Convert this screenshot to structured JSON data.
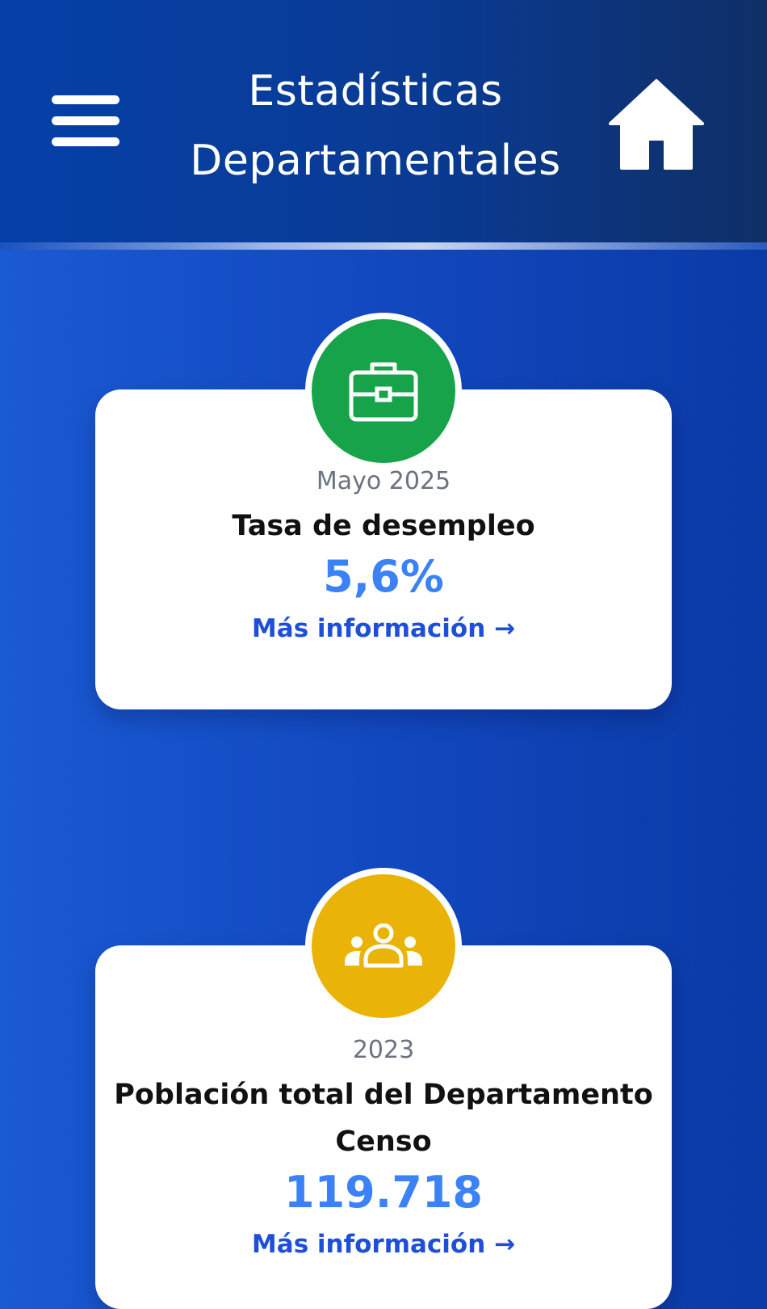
{
  "header": {
    "title_line1": "Estadísticas",
    "title_line2": "Departamentales",
    "menu_icon": "hamburger-menu-icon",
    "home_icon": "home-icon"
  },
  "colors": {
    "header_bg": "#0540a8",
    "page_bg": "#1248bf",
    "card_bg": "#ffffff",
    "unemployment_badge": "#16a34a",
    "population_badge": "#eab308",
    "value_color": "#3b82f6",
    "link_color": "#1d4fd8"
  },
  "cards": [
    {
      "icon": "briefcase-icon",
      "period": "Mayo 2025",
      "label": "Tasa de desempleo",
      "value": "5,6%",
      "link": "Más información →"
    },
    {
      "icon": "people-group-icon",
      "period": "2023",
      "label_line1": "Población total del Departamento",
      "label_line2": "Censo",
      "value": "119.718",
      "link": "Más información →"
    }
  ]
}
